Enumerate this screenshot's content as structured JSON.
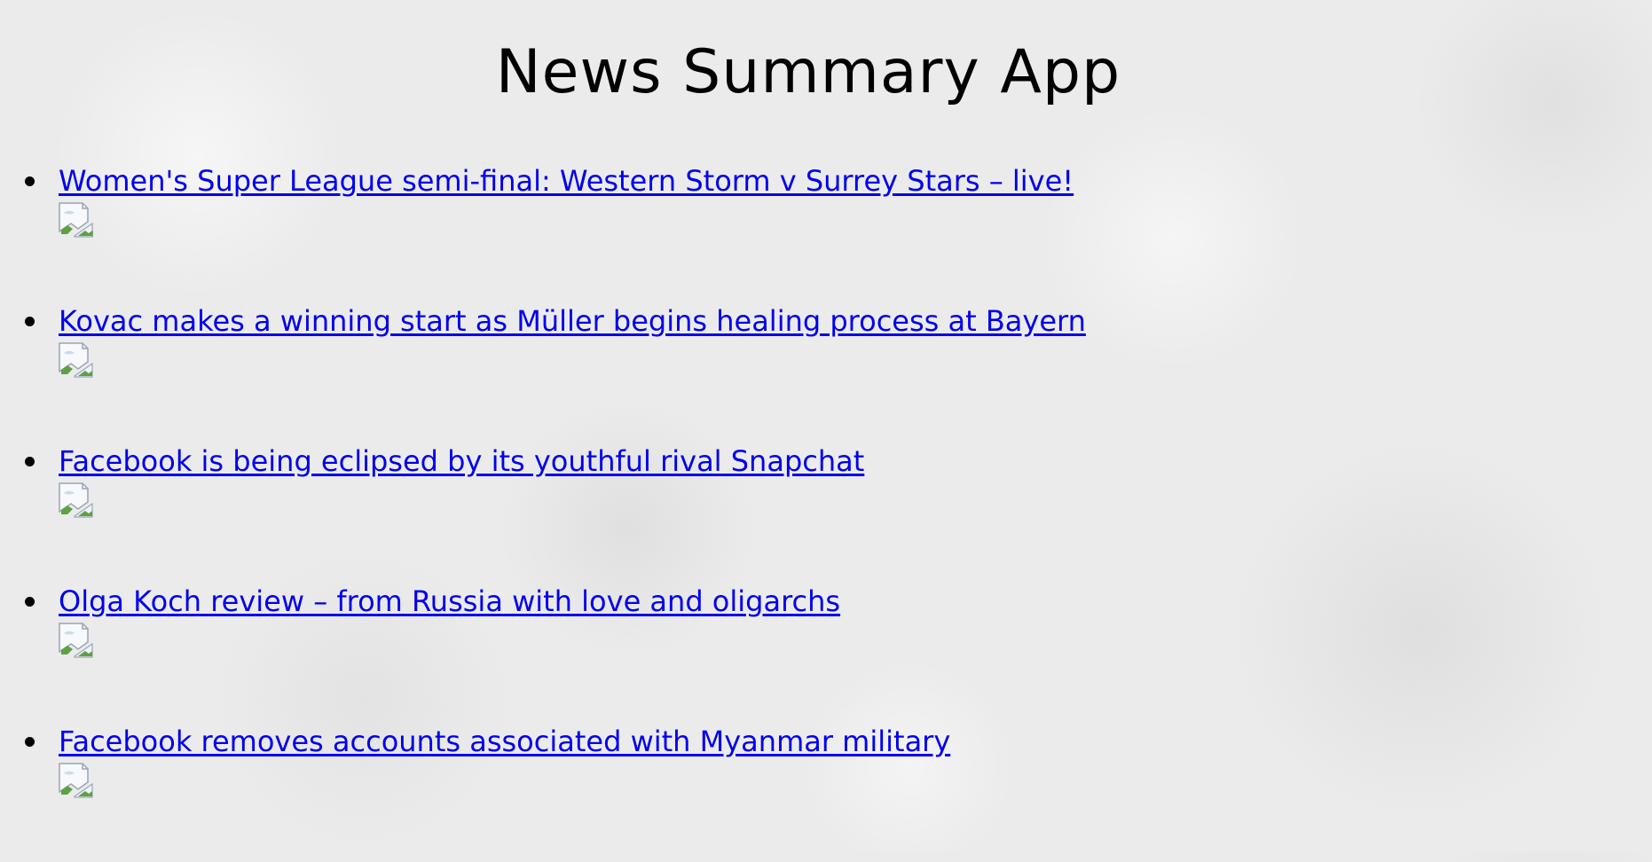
{
  "page": {
    "title": "News Summary App"
  },
  "articles": [
    {
      "headline": "Women's Super League semi-final: Western Storm v Surrey Stars – live!"
    },
    {
      "headline": "Kovac makes a winning start as Müller begins healing process at Bayern"
    },
    {
      "headline": "Facebook is being eclipsed by its youthful rival Snapchat"
    },
    {
      "headline": "Olga Koch review – from Russia with love and oligarchs"
    },
    {
      "headline": "Facebook removes accounts associated with Myanmar military"
    }
  ],
  "colors": {
    "link": "#0000ee",
    "background": "#ebebeb",
    "text": "#000000"
  },
  "icons": {
    "thumbnail": "broken-image-icon"
  }
}
